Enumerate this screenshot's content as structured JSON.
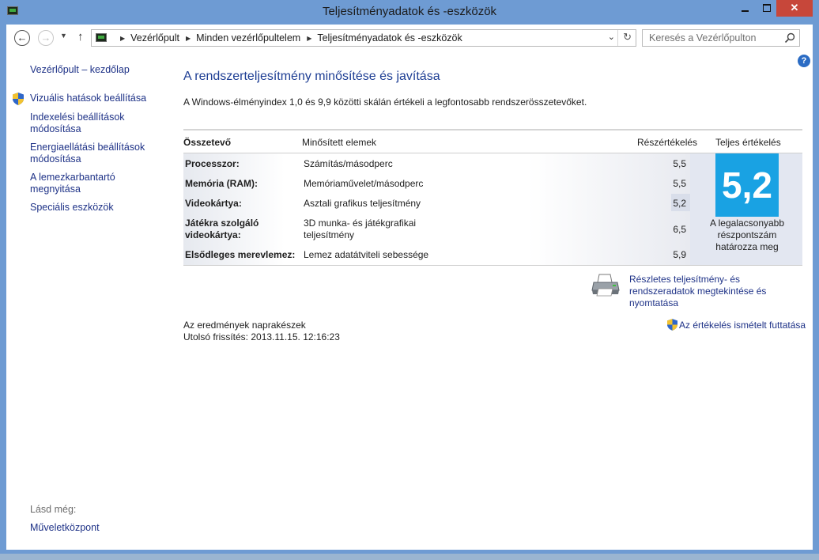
{
  "window": {
    "title": "Teljesítményadatok és -eszközök"
  },
  "breadcrumb": [
    "Vezérlőpult",
    "Minden vezérlőpultelem",
    "Teljesítményadatok és -eszközök"
  ],
  "search": {
    "placeholder": "Keresés a Vezérlőpulton"
  },
  "sidebar": {
    "home": "Vezérlőpult – kezdőlap",
    "items": [
      {
        "label": "Vizuális hatások beállítása",
        "icon": "shield-icon"
      },
      {
        "label": "Indexelési beállítások módosítása"
      },
      {
        "label": "Energiaellátási beállítások módosítása"
      },
      {
        "label": "A lemezkarbantartó megnyitása"
      },
      {
        "label": "Speciális eszközök"
      }
    ],
    "see_also": "Lásd még:",
    "action_center": "Műveletközpont"
  },
  "main": {
    "heading": "A rendszerteljesítmény minősítése és javítása",
    "description": "A Windows-élményindex 1,0 és 9,9 közötti skálán értékeli a legfontosabb rendszerösszetevőket.",
    "table": {
      "headers": {
        "component": "Összetevő",
        "rated": "Minősített elemek",
        "subscore": "Részértékelés",
        "base": "Teljes értékelés"
      },
      "rows": [
        {
          "component": "Processzor:",
          "item": "Számítás/másodperc",
          "subscore": "5,5"
        },
        {
          "component": "Memória (RAM):",
          "item": "Memóriaművelet/másodperc",
          "subscore": "5,5"
        },
        {
          "component": "Videokártya:",
          "item": "Asztali grafikus teljesítmény",
          "subscore": "5,2"
        },
        {
          "component": "Játékra szolgáló videokártya:",
          "item": "3D munka- és játékgrafikai teljesítmény",
          "subscore": "6,5"
        },
        {
          "component": "Elsődleges merevlemez:",
          "item": "Lemez adatátviteli sebessége",
          "subscore": "5,9"
        }
      ],
      "base_score": "5,2",
      "base_caption": "A legalacsonyabb részpontszám határozza meg"
    },
    "print_link": "Részletes teljesítmény- és rendszeradatok megtekintése és nyomtatása",
    "status": "Az eredmények naprakészek",
    "last_update": "Utolsó frissítés: 2013.11.15. 12:16:23",
    "rerun_link": "Az értékelés ismételt futtatása"
  },
  "colors": {
    "score_tile": "#19a2e3",
    "link": "#1e3287",
    "heading": "#1e3e94",
    "window_frame": "#6e9bd3"
  }
}
